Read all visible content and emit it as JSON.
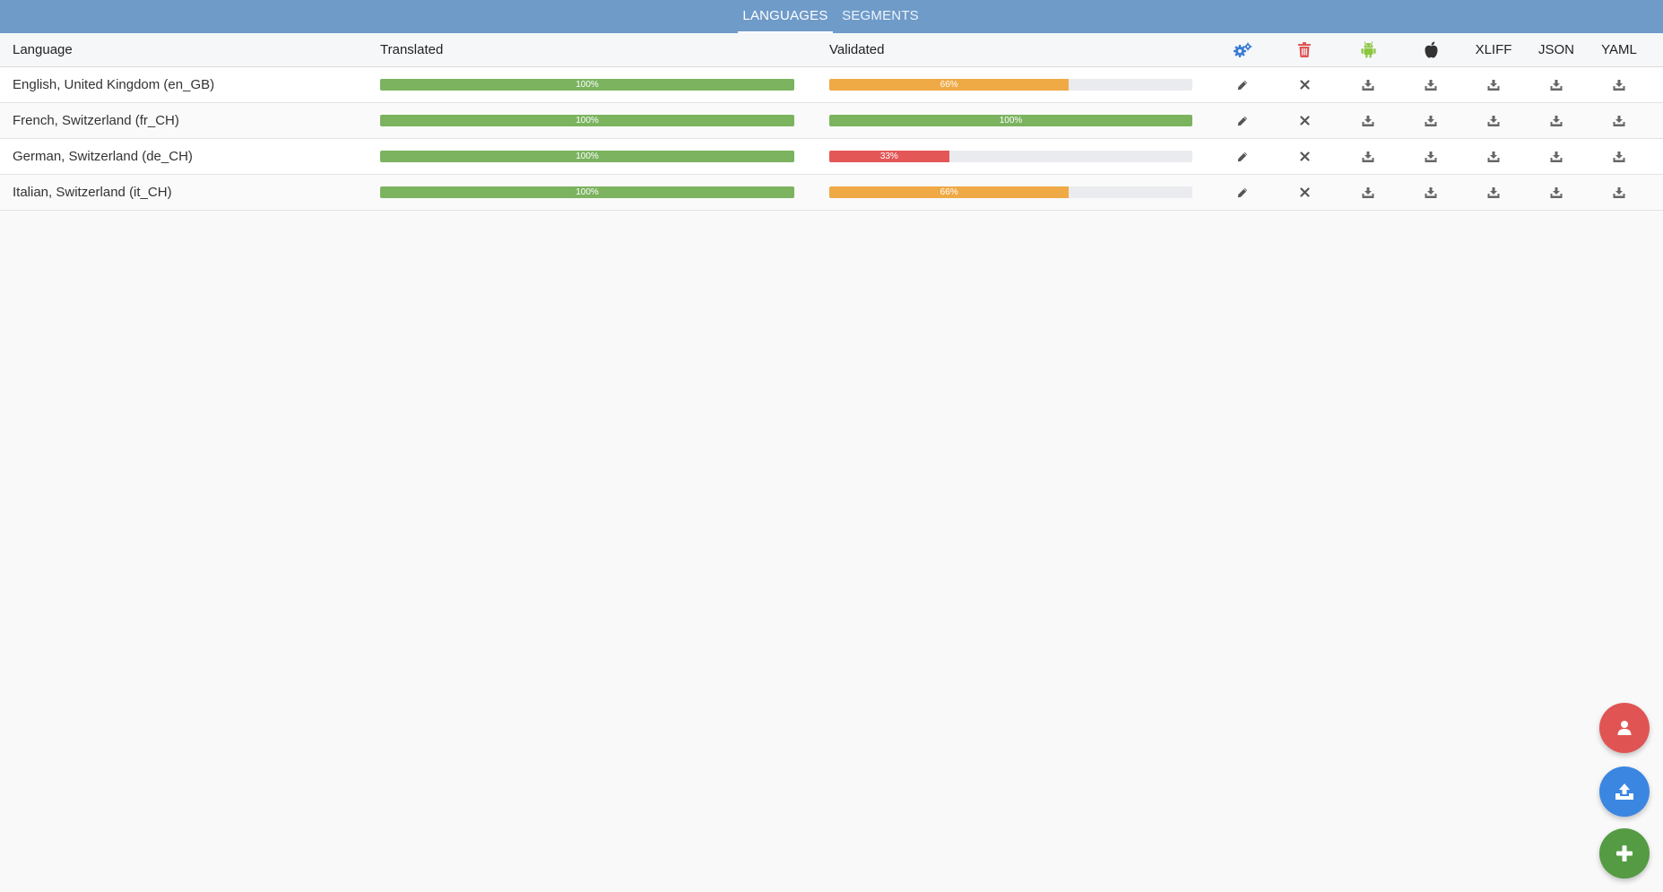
{
  "nav": {
    "tabs": [
      {
        "label": "LANGUAGES",
        "active": true
      },
      {
        "label": "SEGMENTS",
        "active": false
      }
    ]
  },
  "table": {
    "headers": {
      "language": "Language",
      "translated": "Translated",
      "validated": "Validated",
      "settings_icon": "gears-icon",
      "delete_icon": "trash-icon",
      "android_icon": "android-icon",
      "apple_icon": "apple-icon",
      "xliff": "XLIFF",
      "json": "JSON",
      "yaml": "YAML"
    },
    "rows": [
      {
        "language": "English, United Kingdom (en_GB)",
        "translated": 1.0,
        "translated_label": "100%",
        "validated": 0.66,
        "validated_label": "66%",
        "validated_color": "#efa945"
      },
      {
        "language": "French, Switzerland (fr_CH)",
        "translated": 1.0,
        "translated_label": "100%",
        "validated": 1.0,
        "validated_label": "100%",
        "validated_color": "#7bb35f"
      },
      {
        "language": "German, Switzerland (de_CH)",
        "translated": 1.0,
        "translated_label": "100%",
        "validated": 0.33,
        "validated_label": "33%",
        "validated_color": "#e45757"
      },
      {
        "language": "Italian, Switzerland (it_CH)",
        "translated": 1.0,
        "translated_label": "100%",
        "validated": 0.66,
        "validated_label": "66%",
        "validated_color": "#efa945"
      }
    ],
    "row_actions": [
      "pencil-icon",
      "close-icon",
      "download-icon",
      "download-icon",
      "download-icon",
      "download-icon",
      "download-icon"
    ]
  },
  "colors": {
    "topbar": "#6f9bc9",
    "complete": "#7bb35f",
    "warning": "#efa945",
    "danger": "#e45757",
    "settings_icon": "#3a7bd5",
    "delete_icon": "#e05454",
    "android_icon": "#8cc63f",
    "apple_icon": "#333333"
  },
  "fabs": [
    {
      "icon": "user-icon",
      "color": "#e05454"
    },
    {
      "icon": "upload-icon",
      "color": "#3b86e0"
    },
    {
      "icon": "plus-icon",
      "color": "#549b43"
    }
  ]
}
